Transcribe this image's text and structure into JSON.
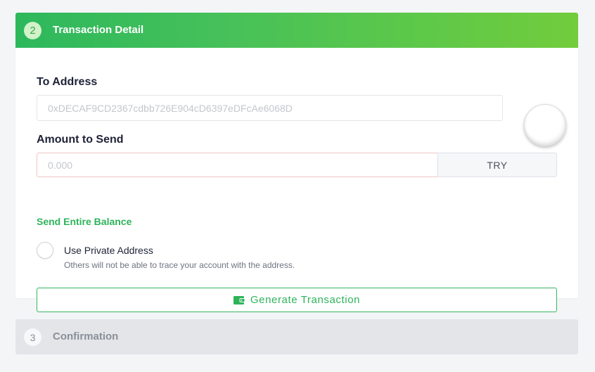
{
  "step_detail": {
    "number": "2",
    "title": "Transaction Detail"
  },
  "to_address": {
    "label": "To Address",
    "placeholder": "0xDECAF9CD2367cdbb726E904cD6397eDFcAe6068D",
    "value": ""
  },
  "amount": {
    "label": "Amount to Send",
    "placeholder": "0.000",
    "value": "",
    "currency": "TRY",
    "entire_balance_label": "Send Entire Balance"
  },
  "private_address": {
    "label": "Use Private Address",
    "hint": "Others will not be able to trace your account with the address.",
    "checked": false
  },
  "generate": {
    "label": "Generate Transaction",
    "icon": "wallet-icon"
  },
  "step_confirmation": {
    "number": "3",
    "title": "Confirmation"
  },
  "colors": {
    "accent_green": "#2eb35a",
    "header_gradient_start": "#2db85c",
    "header_gradient_end": "#72cc3c",
    "error_border": "#f1c6c6"
  }
}
